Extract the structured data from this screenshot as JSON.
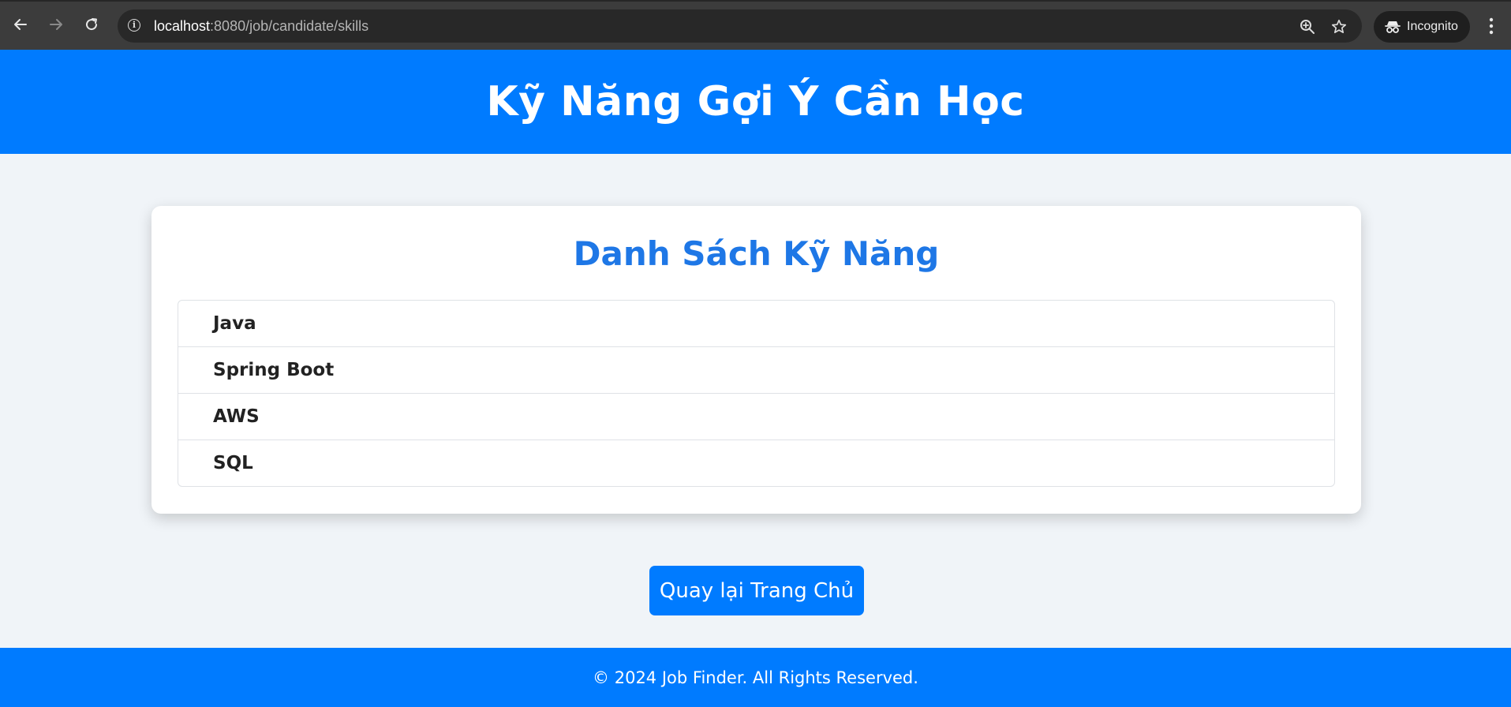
{
  "browser": {
    "url_host": "localhost",
    "url_path": ":8080/job/candidate/skills",
    "incognito_label": "Incognito",
    "icons": {
      "back": "arrow-left-icon",
      "forward": "arrow-right-icon",
      "reload": "reload-icon",
      "site_info": "info-icon",
      "zoom": "zoom-in-icon",
      "bookmark": "star-icon",
      "incognito": "incognito-icon",
      "menu": "kebab-menu-icon"
    }
  },
  "header": {
    "title": "Kỹ Năng Gợi Ý Cần Học"
  },
  "card": {
    "title": "Danh Sách Kỹ Năng",
    "skills": [
      "Java",
      "Spring Boot",
      "AWS",
      "SQL"
    ]
  },
  "back_button": {
    "label": "Quay lại Trang Chủ"
  },
  "footer": {
    "text": "© 2024 Job Finder. All Rights Reserved."
  },
  "colors": {
    "primary": "#007bff",
    "card_title": "#1e77e6",
    "page_background": "#f0f4f8",
    "browser_chrome": "#3c3c3c"
  }
}
